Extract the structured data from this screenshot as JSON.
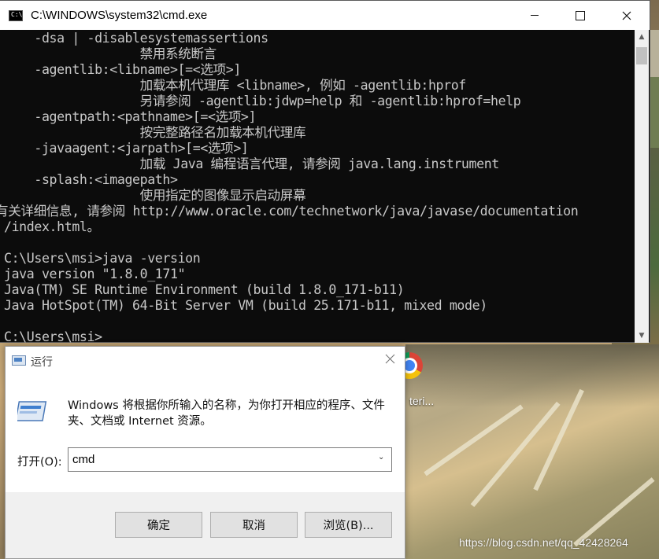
{
  "cmd": {
    "title": "C:\\WINDOWS\\system32\\cmd.exe",
    "icon_text": "C:\\",
    "lines": [
      "    -dsa | -disablesystemassertions",
      "                  禁用系统断言",
      "    -agentlib:<libname>[=<选项>]",
      "                  加载本机代理库 <libname>, 例如 -agentlib:hprof",
      "                  另请参阅 -agentlib:jdwp=help 和 -agentlib:hprof=help",
      "    -agentpath:<pathname>[=<选项>]",
      "                  按完整路径名加载本机代理库",
      "    -javaagent:<jarpath>[=<选项>]",
      "                  加载 Java 编程语言代理, 请参阅 java.lang.instrument",
      "    -splash:<imagepath>",
      "                  使用指定的图像显示启动屏幕",
      "有关详细信息, 请参阅 http://www.oracle.com/technetwork/java/javase/documentation",
      "/index.html。",
      "",
      "C:\\Users\\msi>java -version",
      "java version \"1.8.0_171\"",
      "Java(TM) SE Runtime Environment (build 1.8.0_171-b11)",
      "Java HotSpot(TM) 64-Bit Server VM (build 25.171-b11, mixed mode)",
      "",
      "C:\\Users\\msi>"
    ]
  },
  "run": {
    "title": "运行",
    "message": "Windows 将根据你所输入的名称，为你打开相应的程序、文件夹、文档或 Internet 资源。",
    "open_label": "打开(O):",
    "input_value": "cmd",
    "ok_label": "确定",
    "cancel_label": "取消",
    "browse_label": "浏览(B)..."
  },
  "desktop": {
    "icon_label": "teri...",
    "watermark": "https://blog.csdn.net/qq_42428264"
  },
  "colors": {
    "console_bg": "#0c0c0c",
    "console_fg": "#c8c8c8",
    "dialog_footer": "#f0f0f0"
  }
}
